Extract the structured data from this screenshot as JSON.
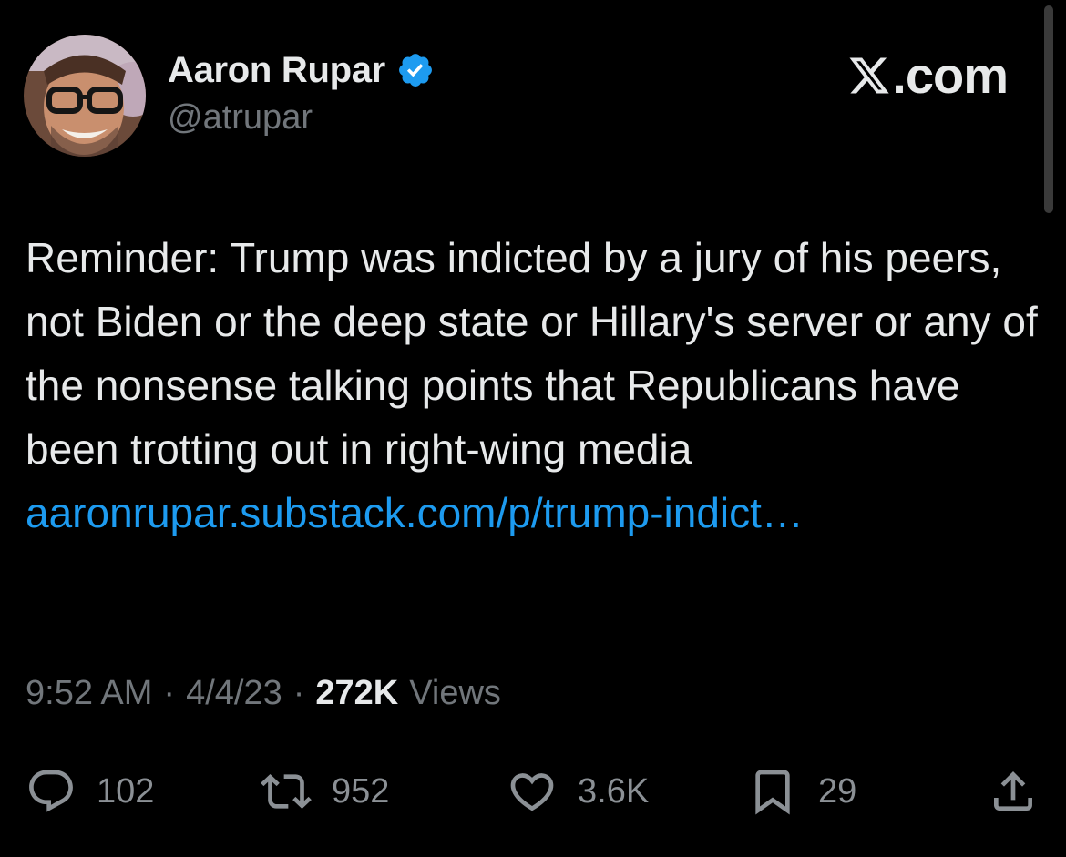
{
  "author": {
    "display_name": "Aaron Rupar",
    "handle": "@atrupar",
    "verified": true
  },
  "brand": {
    "label": ".com",
    "icon": "x-logo-icon"
  },
  "tweet": {
    "text": "Reminder: Trump was indicted by a jury of his peers, not Biden or the deep state or Hillary's server or any of the nonsense talking points that Republicans have been trotting out in right-wing media ",
    "link": "aaronrupar.substack.com/p/trump-indict…"
  },
  "meta": {
    "time": "9:52 AM",
    "date": "4/4/23",
    "separator": "·",
    "views_count": "272K",
    "views_label": "Views"
  },
  "actions": {
    "replies": "102",
    "reposts": "952",
    "likes": "3.6K",
    "bookmarks": "29"
  },
  "colors": {
    "background": "#000000",
    "text": "#e7e9ea",
    "secondary": "#71767b",
    "link": "#1d9bf0",
    "verified": "#1d9bf0"
  }
}
